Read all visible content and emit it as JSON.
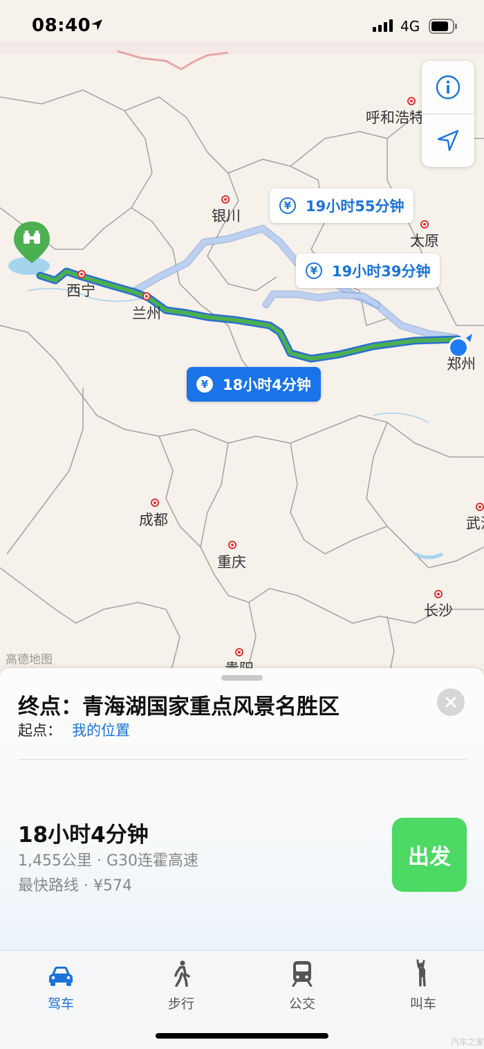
{
  "status_bar": {
    "time": "08:40",
    "network": "4G",
    "icons": [
      "location-arrow-icon",
      "signal-bars-icon",
      "battery-icon"
    ]
  },
  "map": {
    "colors": {
      "background": "#f6f1ea",
      "primary_route": "#4caf50",
      "primary_route_outline": "#2c7be5",
      "alternate_route": "#a9c4ee",
      "city_dot": "#e0302e",
      "current_location": "#1e7cf2",
      "destination_pin": "#4caf50"
    },
    "cities": [
      {
        "key": "hohhot",
        "name": "呼和浩特"
      },
      {
        "key": "yinchuan",
        "name": "银川"
      },
      {
        "key": "taiyuan",
        "name": "太原"
      },
      {
        "key": "xining",
        "name": "西宁"
      },
      {
        "key": "lanzhou",
        "name": "兰州"
      },
      {
        "key": "zhengzhou",
        "name": "郑州"
      },
      {
        "key": "chengdu",
        "name": "成都"
      },
      {
        "key": "wuhan",
        "name": "武汉"
      },
      {
        "key": "chongqing",
        "name": "重庆"
      },
      {
        "key": "changsha",
        "name": "长沙"
      },
      {
        "key": "guiyang",
        "name": "贵阳"
      }
    ],
    "route_labels": [
      {
        "key": "alt1",
        "text": "19小时55分钟",
        "icon": "yen-icon",
        "selected": false
      },
      {
        "key": "alt2",
        "text": "19小时39分钟",
        "icon": "yen-icon",
        "selected": false
      },
      {
        "key": "main",
        "text": "18小时4分钟",
        "icon": "yen-icon",
        "selected": true
      }
    ],
    "attribution": "高德地图",
    "controls": {
      "info_icon": "info-icon",
      "locate_icon": "location-arrow-icon"
    },
    "destination_pin_icon": "binoculars-icon"
  },
  "sheet": {
    "destination_text": "终点：青海湖国家重点风景名胜区",
    "origin_label": "起点：",
    "origin_value": "我的位置",
    "route": {
      "duration": "18小时4分钟",
      "detail_line1": "1,455公里 · G30连霍高速",
      "detail_line2": "最快路线 · ¥574"
    },
    "go_button": "出发",
    "go_color": "#4cd964"
  },
  "tabbar": {
    "active_color": "#1a73d9",
    "tabs": [
      {
        "label": "驾车",
        "icon": "car-icon",
        "active": true
      },
      {
        "label": "步行",
        "icon": "walking-person-icon",
        "active": false
      },
      {
        "label": "公交",
        "icon": "train-icon",
        "active": false
      },
      {
        "label": "叫车",
        "icon": "hail-person-icon",
        "active": false
      }
    ]
  },
  "watermark": "汽车之家"
}
